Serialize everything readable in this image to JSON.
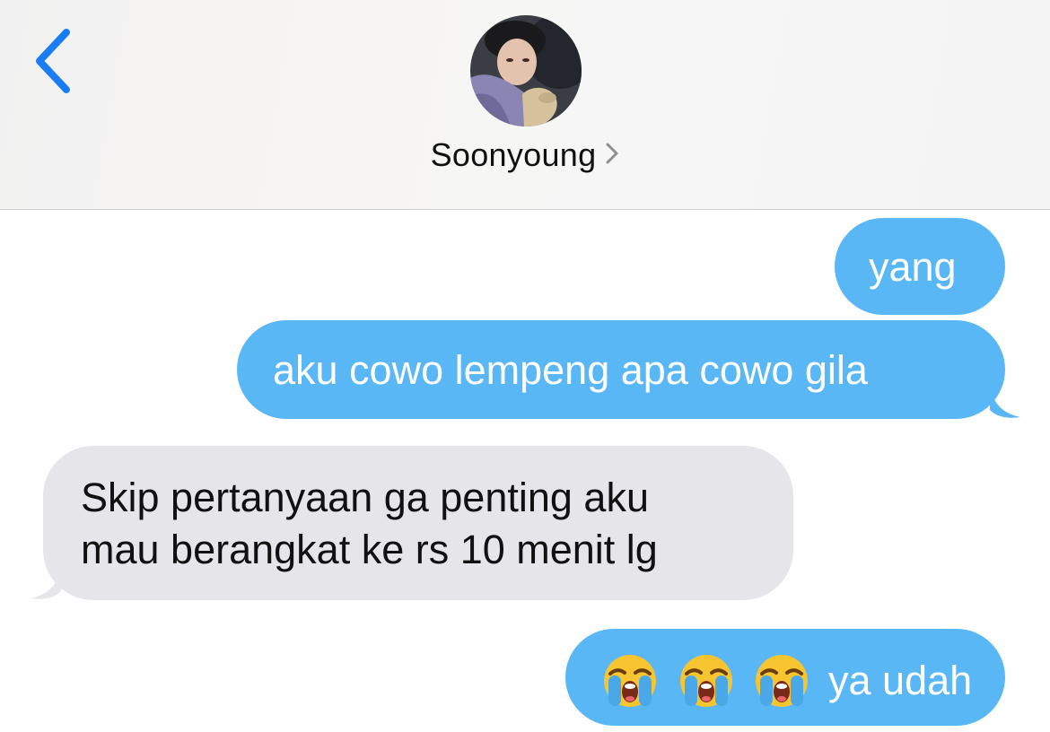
{
  "header": {
    "back_icon": "chevron-left-icon",
    "contact_name": "Soonyoung",
    "name_chevron_icon": "chevron-right-icon",
    "avatar_icon": "contact-avatar-photo"
  },
  "colors": {
    "accent_blue": "#1a7cf5",
    "sent_bubble": "#5ab7f6",
    "received_bubble": "#e5e5ea"
  },
  "messages": [
    {
      "direction": "sent",
      "text": "yang"
    },
    {
      "direction": "sent",
      "text": "aku cowo lempeng apa cowo gila"
    },
    {
      "direction": "received",
      "lines": [
        "Skip pertanyaan ga penting aku",
        "mau berangkat ke rs 10 menit lg"
      ]
    },
    {
      "direction": "sent",
      "emojis": [
        "loudly-crying-face",
        "loudly-crying-face",
        "loudly-crying-face"
      ],
      "text": "ya udah"
    }
  ]
}
